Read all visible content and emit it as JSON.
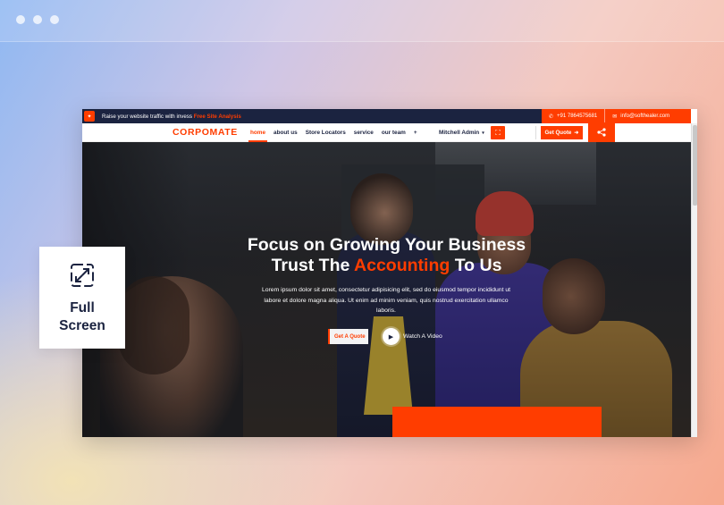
{
  "window": {
    "dots": 3
  },
  "site": {
    "topbar": {
      "promo_text": "Raise your website traffic with invess",
      "promo_link": "Free Site Analysis",
      "phone": "+91 7864575681",
      "email": "info@softhealer.com"
    },
    "navbar": {
      "brand": "CORPOMATE",
      "links": [
        "home",
        "about us",
        "Store Locators",
        "service",
        "our team",
        "+"
      ],
      "admin": "Mitchell Admin",
      "quote_button": "Get Quote"
    },
    "hero": {
      "title_line1": "Focus on Growing Your Business",
      "title_line2_pre": "Trust The",
      "title_line2_accent": "Accounting",
      "title_line2_post": "To Us",
      "description": "Lorem ipsum dolor sit amet, consectetur adipisicing elit, sed do eiusmod tempor incididunt ut labore et dolore magna aliqua. Ut enim ad minim veniam, quis nostrud exercitation ullamco laboris.",
      "cta_button": "Get A Quote",
      "video_label": "Watch A Video"
    }
  },
  "fullscreen_card": {
    "label": "Full Screen",
    "icon": "expand-arrows-icon"
  },
  "colors": {
    "accent": "#ff3d00",
    "navy": "#1b2340"
  }
}
